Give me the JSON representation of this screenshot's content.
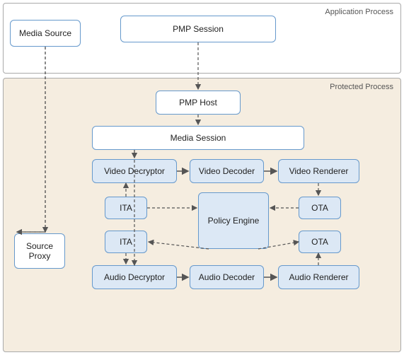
{
  "regions": {
    "app_process_label": "Application Process",
    "protected_process_label": "Protected Process"
  },
  "boxes": {
    "media_source": "Media Source",
    "pmp_session": "PMP Session",
    "pmp_host": "PMP Host",
    "media_session": "Media Session",
    "video_decryptor": "Video Decryptor",
    "video_decoder": "Video Decoder",
    "video_renderer": "Video Renderer",
    "ita_top": "ITA",
    "ota_top": "OTA",
    "policy_engine": "Policy Engine",
    "ita_bottom": "ITA",
    "ota_bottom": "OTA",
    "audio_decryptor": "Audio Decryptor",
    "audio_decoder": "Audio Decoder",
    "audio_renderer": "Audio Renderer",
    "source_proxy": "Source\nProxy"
  }
}
